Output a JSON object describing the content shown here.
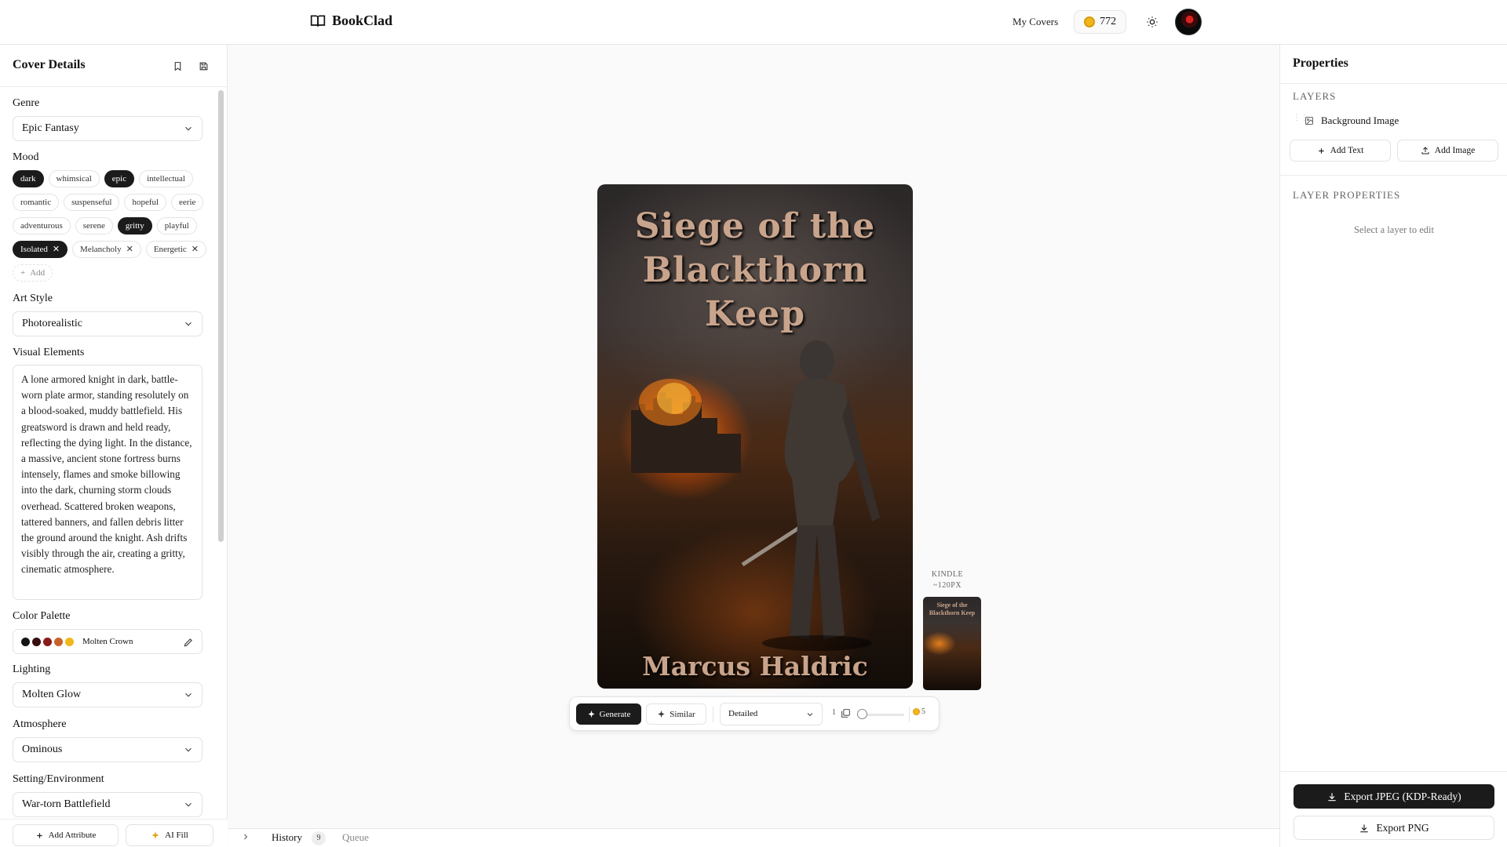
{
  "app": {
    "name": "BookClad"
  },
  "header": {
    "my_covers": "My Covers",
    "credits": "772"
  },
  "left_panel": {
    "title": "Cover Details",
    "genre": {
      "label": "Genre",
      "value": "Epic Fantasy"
    },
    "mood": {
      "label": "Mood",
      "chips": [
        {
          "label": "dark",
          "selected": true,
          "removable": false
        },
        {
          "label": "whimsical",
          "selected": false,
          "removable": false
        },
        {
          "label": "epic",
          "selected": true,
          "removable": false
        },
        {
          "label": "intellectual",
          "selected": false,
          "removable": false
        },
        {
          "label": "romantic",
          "selected": false,
          "removable": false
        },
        {
          "label": "suspenseful",
          "selected": false,
          "removable": false
        },
        {
          "label": "hopeful",
          "selected": false,
          "removable": false
        },
        {
          "label": "eerie",
          "selected": false,
          "removable": false
        },
        {
          "label": "adventurous",
          "selected": false,
          "removable": false
        },
        {
          "label": "serene",
          "selected": false,
          "removable": false
        },
        {
          "label": "gritty",
          "selected": true,
          "removable": false
        },
        {
          "label": "playful",
          "selected": false,
          "removable": false
        },
        {
          "label": "Isolated",
          "selected": true,
          "removable": true
        },
        {
          "label": "Melancholy",
          "selected": false,
          "removable": true
        },
        {
          "label": "Energetic",
          "selected": false,
          "removable": true
        }
      ],
      "add_label": "Add"
    },
    "art_style": {
      "label": "Art Style",
      "value": "Photorealistic"
    },
    "visual_elements": {
      "label": "Visual Elements",
      "value": "A lone armored knight in dark, battle-worn plate armor, standing resolutely on a blood-soaked, muddy battlefield. His greatsword is drawn and held ready, reflecting the dying light. In the distance, a massive, ancient stone fortress burns intensely, flames and smoke billowing into the dark, churning storm clouds overhead. Scattered broken weapons, tattered banners, and fallen debris litter the ground around the knight. Ash drifts visibly through the air, creating a gritty, cinematic atmosphere."
    },
    "color_palette": {
      "label": "Color Palette",
      "name": "Molten Crown",
      "swatches": [
        "#141414",
        "#3a0d0d",
        "#8b1a1a",
        "#c8622a",
        "#f0b81c"
      ]
    },
    "lighting": {
      "label": "Lighting",
      "value": "Molten Glow"
    },
    "atmosphere": {
      "label": "Atmosphere",
      "value": "Ominous"
    },
    "setting": {
      "label": "Setting/Environment",
      "value": "War-torn Battlefield"
    },
    "add_attribute": "Add Attribute",
    "ai_fill": "AI Fill"
  },
  "canvas": {
    "cover": {
      "title": "Siege of the Blackthorn Keep",
      "author": "Marcus Haldric"
    },
    "kindle": {
      "label_line1": "KINDLE",
      "label_line2": "~120PX",
      "thumb_title": "Siege of the Blackthorn Keep"
    },
    "generate_bar": {
      "generate": "Generate",
      "similar": "Similar",
      "detail_select": "Detailed",
      "count": "1",
      "cost": "5"
    }
  },
  "bottom_tabs": {
    "history": "History",
    "history_count": "9",
    "queue": "Queue"
  },
  "right_panel": {
    "title": "Properties",
    "layers_heading": "LAYERS",
    "layer_name": "Background Image",
    "add_text": "Add Text",
    "add_image": "Add Image",
    "layer_props_heading": "LAYER PROPERTIES",
    "empty_hint": "Select a layer to edit",
    "export_jpeg": "Export JPEG (KDP-Ready)",
    "export_png": "Export PNG"
  }
}
